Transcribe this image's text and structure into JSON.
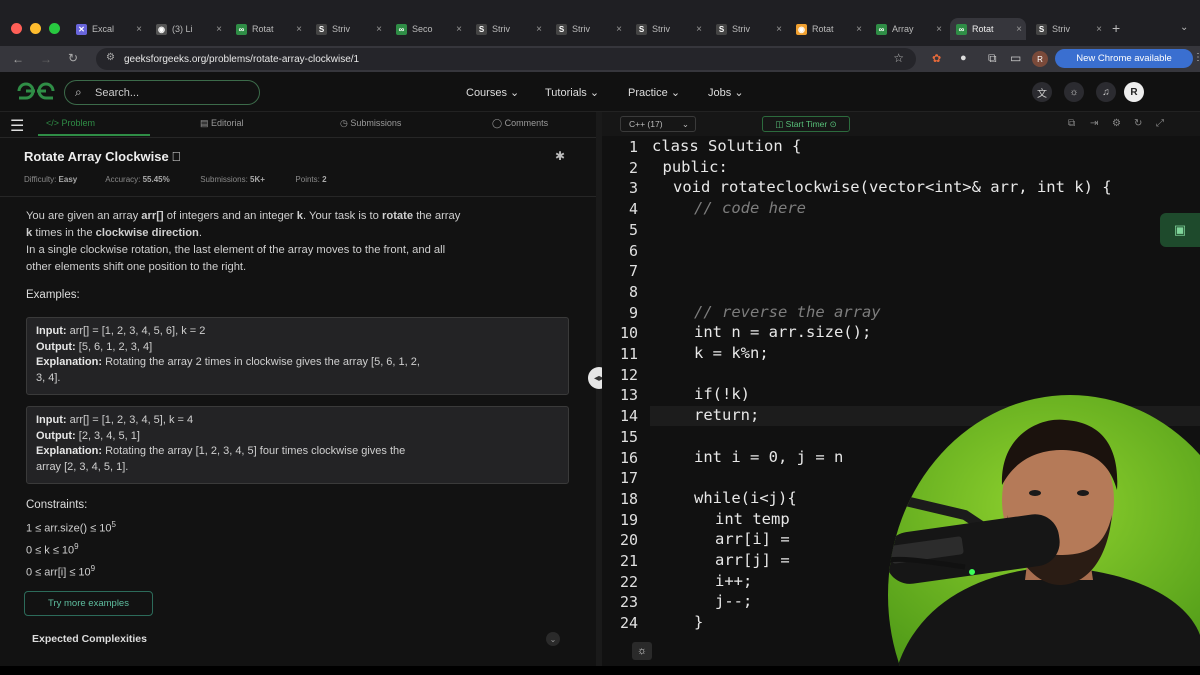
{
  "browser": {
    "tabs": [
      {
        "label": "Excal",
        "icon": "excalidraw-icon",
        "color": "#6965db"
      },
      {
        "label": "(3) Li",
        "icon": "globe-icon",
        "color": "#555"
      },
      {
        "label": "Rotat",
        "icon": "gfg-icon",
        "color": "#2f8d46"
      },
      {
        "label": "Striv",
        "icon": "striver-icon",
        "color": "#444"
      },
      {
        "label": "Seco",
        "icon": "gfg-icon",
        "color": "#2f8d46"
      },
      {
        "label": "Striv",
        "icon": "striver-icon",
        "color": "#444"
      },
      {
        "label": "Striv",
        "icon": "striver-icon",
        "color": "#444"
      },
      {
        "label": "Striv",
        "icon": "striver-icon",
        "color": "#444"
      },
      {
        "label": "Striv",
        "icon": "striver-icon",
        "color": "#444"
      },
      {
        "label": "Rotat",
        "icon": "leetcode-icon",
        "color": "#f0a030"
      },
      {
        "label": "Array",
        "icon": "gfg-icon",
        "color": "#2f8d46"
      },
      {
        "label": "Rotat",
        "icon": "gfg-icon",
        "color": "#2f8d46"
      },
      {
        "label": "Striv",
        "icon": "striver-icon",
        "color": "#444"
      }
    ],
    "url": "geeksforgeeks.org/problems/rotate-array-clockwise/1",
    "new_chrome": "New Chrome available",
    "profile_letter": "R"
  },
  "site": {
    "logo": "GfG",
    "search_placeholder": "Search...",
    "nav": [
      "Courses",
      "Tutorials",
      "Practice",
      "Jobs"
    ],
    "avatar": "R"
  },
  "left": {
    "tabs": [
      "Problem",
      "Editorial",
      "Submissions",
      "Comments"
    ],
    "title": "Rotate Array Clockwise",
    "meta": {
      "difficulty_label": "Difficulty:",
      "difficulty": "Easy",
      "accuracy_label": "Accuracy:",
      "accuracy": "55.45%",
      "submissions_label": "Submissions:",
      "submissions": "5K+",
      "points_label": "Points:",
      "points": "2"
    },
    "desc": {
      "p1a": "You are given an array ",
      "p1b": "arr[]",
      "p1c": " of integers and an integer ",
      "p1d": "k",
      "p1e": ". Your task is to ",
      "p1f": "rotate",
      "p1g": " the array",
      "p2a": "k",
      "p2b": " times in the ",
      "p2c": "clockwise direction",
      "p2d": ".",
      "p3": "In a single clockwise rotation, the last element of the array moves to the front, and all",
      "p4": "other elements shift one position to the right."
    },
    "examples_label": "Examples:",
    "examples": [
      {
        "input_label": "Input:",
        "input": "arr[] = [1, 2, 3, 4, 5, 6], k = 2",
        "output_label": "Output:",
        "output": "[5, 6, 1, 2, 3, 4]",
        "expl_label": "Explanation:",
        "expl1": "Rotating the array 2 times in clockwise gives the array [5, 6, 1, 2,",
        "expl2": "3, 4]."
      },
      {
        "input_label": "Input:",
        "input": "arr[] = [1, 2, 3, 4, 5], k = 4",
        "output_label": "Output:",
        "output": "[2, 3, 4, 5, 1]",
        "expl_label": "Explanation:",
        "expl1": "Rotating the array [1, 2, 3, 4, 5] four times clockwise gives the",
        "expl2": "array [2, 3, 4, 5, 1]."
      }
    ],
    "constraints_label": "Constraints:",
    "constraints": [
      {
        "text": "1 ≤ arr.size() ≤ 10",
        "sup": "5"
      },
      {
        "text": "0 ≤ k ≤ 10",
        "sup": "9"
      },
      {
        "text": "0 ≤ arr[i] ≤ 10",
        "sup": "9"
      }
    ],
    "try_more": "Try more examples",
    "expected": "Expected Complexities"
  },
  "editor": {
    "language": "C++ (17)",
    "timer": "Start Timer",
    "lines": [
      {
        "n": "1",
        "code": "class Solution {",
        "indent": 0
      },
      {
        "n": "2",
        "code": "public:",
        "indent": 1
      },
      {
        "n": "3",
        "code": "void rotateclockwise(vector<int>& arr, int k) {",
        "indent": 2
      },
      {
        "n": "4",
        "code": "// code here",
        "indent": 4,
        "comment": true
      },
      {
        "n": "5",
        "code": "",
        "indent": 0
      },
      {
        "n": "6",
        "code": "",
        "indent": 0
      },
      {
        "n": "7",
        "code": "",
        "indent": 0
      },
      {
        "n": "8",
        "code": "",
        "indent": 0
      },
      {
        "n": "9",
        "code": "// reverse the array",
        "indent": 4,
        "comment": true
      },
      {
        "n": "10",
        "code": "int n = arr.size();",
        "indent": 4
      },
      {
        "n": "11",
        "code": "k = k%n;",
        "indent": 4
      },
      {
        "n": "12",
        "code": "",
        "indent": 0
      },
      {
        "n": "13",
        "code": "if(!k)",
        "indent": 4
      },
      {
        "n": "14",
        "code": "return;",
        "indent": 4
      },
      {
        "n": "15",
        "code": "",
        "indent": 0
      },
      {
        "n": "16",
        "code": "int i = 0, j = n",
        "indent": 4
      },
      {
        "n": "17",
        "code": "",
        "indent": 0
      },
      {
        "n": "18",
        "code": "while(i<j){",
        "indent": 4
      },
      {
        "n": "19",
        "code": "int temp",
        "indent": 6
      },
      {
        "n": "20",
        "code": "arr[i] =",
        "indent": 6
      },
      {
        "n": "21",
        "code": "arr[j] =",
        "indent": 6
      },
      {
        "n": "22",
        "code": "i++;",
        "indent": 6
      },
      {
        "n": "23",
        "code": "j--;",
        "indent": 6
      },
      {
        "n": "24",
        "code": "}",
        "indent": 4
      }
    ]
  },
  "colors": {
    "accent_green": "#2f8d46",
    "chrome_blue": "#3a6fd0"
  }
}
